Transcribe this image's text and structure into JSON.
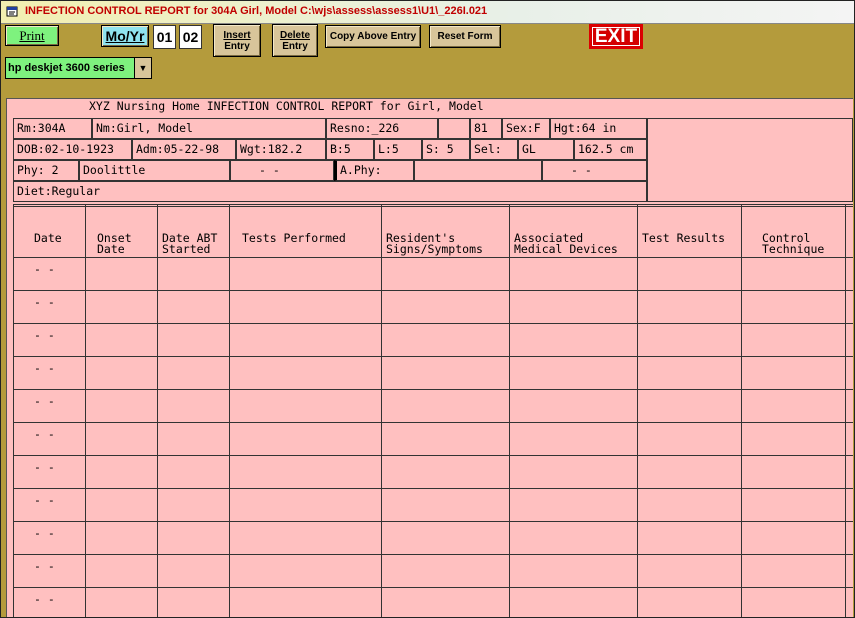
{
  "window": {
    "title": "INFECTION CONTROL REPORT for 304A Girl, Model  C:\\wjs\\assess\\assess1\\U1\\_226I.021"
  },
  "toolbar": {
    "print_label": "Print",
    "moyr_label": "Mo/Yr",
    "month": "01",
    "year": "02",
    "insert_line1": "Insert",
    "insert_line2": "Entry",
    "delete_line1": "Delete",
    "delete_line2": "Entry",
    "copy_label": "Copy Above Entry",
    "reset_label": "Reset Form",
    "exit_label": "EXIT",
    "printer_value": "hp deskjet 3600 series"
  },
  "report": {
    "title": "XYZ Nursing Home INFECTION CONTROL REPORT for Girl, Model",
    "rm": "Rm:304A",
    "nm": "Nm:Girl, Model",
    "resno": "Resno:_226",
    "blank": "",
    "age": "81",
    "sex": "Sex:F",
    "hgt": "Hgt:64   in",
    "dob": "DOB:02-10-1923",
    "adm": "Adm:05-22-98",
    "wgt": "Wgt:182.2",
    "b": "B:5",
    "l": "L:5",
    "s": "S: 5",
    "sel": "Sel:",
    "sel_value": "GL",
    "cm": "162.5 cm",
    "phy": "Phy: 2",
    "phy_name": "Doolittle",
    "phy_phone": "-   -",
    "aphy": "A.Phy:",
    "aphy_name": "",
    "aphy_phone": "-   -",
    "diet": "Diet:Regular"
  },
  "table": {
    "headers": [
      {
        "line1": "",
        "line2": "Date"
      },
      {
        "line1": "Onset",
        "line2": "Date"
      },
      {
        "line1": "Date ABT",
        "line2": "Started"
      },
      {
        "line1": "",
        "line2": "Tests Performed"
      },
      {
        "line1": "Resident's",
        "line2": "Signs/Symptoms"
      },
      {
        "line1": "Associated",
        "line2": "Medical Devices"
      },
      {
        "line1": "",
        "line2": "Test Results"
      },
      {
        "line1": "Control",
        "line2": "Technique"
      }
    ],
    "rows": [
      {
        "date": "-  -"
      },
      {
        "date": "-  -"
      },
      {
        "date": "-  -"
      },
      {
        "date": "-  -"
      },
      {
        "date": "-  -"
      },
      {
        "date": "-  -"
      },
      {
        "date": "-  -"
      },
      {
        "date": "-  -"
      },
      {
        "date": "-  -"
      },
      {
        "date": "-  -"
      },
      {
        "date": "-  -"
      }
    ]
  }
}
